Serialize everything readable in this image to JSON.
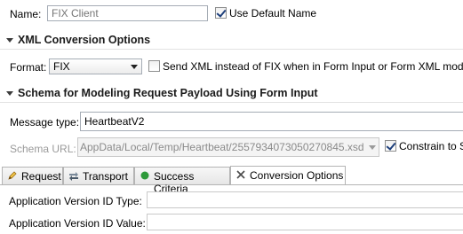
{
  "name_row": {
    "label": "Name:",
    "placeholder": "FIX Client",
    "use_default_label": "Use Default Name"
  },
  "xml_section": {
    "title": "XML Conversion Options",
    "format_label": "Format:",
    "format_value": "FIX",
    "send_xml_label": "Send XML instead of FIX when in Form Input or Form XML mode"
  },
  "schema_section": {
    "title": "Schema for Modeling Request Payload Using Form Input",
    "message_type_label": "Message type:",
    "message_type_value": "HeartbeatV2",
    "schema_url_label": "Schema URL:",
    "schema_url_value": "AppData/Local/Temp/Heartbeat/2557934073050270845.xsd",
    "constrain_label": "Constrain to S"
  },
  "tabs": [
    {
      "label": "Request",
      "icon": "pencil-icon"
    },
    {
      "label": "Transport",
      "icon": "transport-icon"
    },
    {
      "label": "Success Criteria",
      "icon": "green-circle-icon"
    },
    {
      "label": "Conversion Options",
      "icon": "conversion-icon"
    }
  ],
  "properties": [
    {
      "label": "Application Version ID Type:",
      "value": ""
    },
    {
      "label": "Application Version ID Value:",
      "value": ""
    }
  ],
  "colors": {
    "section_line": "#e2e2e2",
    "success_icon": "#2e9a3a",
    "checkbox_mark": "#1d3f7b"
  }
}
